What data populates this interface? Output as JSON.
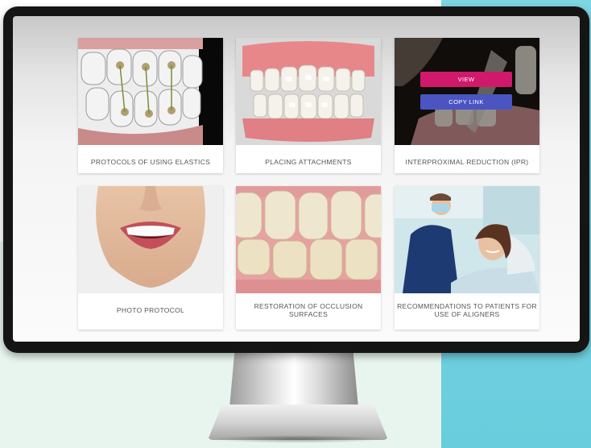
{
  "cards": [
    {
      "title": "PROTOCOLS OF USING ELASTICS"
    },
    {
      "title": "PLACING ATTACHMENTS"
    },
    {
      "title": "INTERPROXIMAL REDUCTION (IPR)"
    },
    {
      "title": "PHOTO PROTOCOL"
    },
    {
      "title": "RESTORATION OF OCCLUSION SURFACES"
    },
    {
      "title": "RECOMMENDATIONS TO PATIENTS FOR USE OF ALIGNERS"
    }
  ],
  "overlay": {
    "view_label": "VIEW",
    "copy_label": "COPY LINK"
  },
  "colors": {
    "view": "#d0196b",
    "copy": "#4a55c2",
    "teal_bg": "#6fd0df"
  }
}
